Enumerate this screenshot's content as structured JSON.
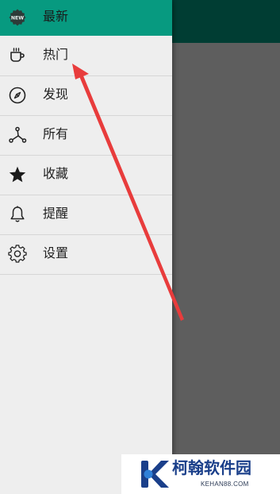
{
  "drawer": {
    "items": [
      {
        "label": "最新",
        "icon": "new-badge-icon",
        "selected": true
      },
      {
        "label": "热门",
        "icon": "coffee-cup-icon",
        "selected": false
      },
      {
        "label": "发现",
        "icon": "compass-icon",
        "selected": false
      },
      {
        "label": "所有",
        "icon": "share-nodes-icon",
        "selected": false
      },
      {
        "label": "收藏",
        "icon": "star-icon",
        "selected": false
      },
      {
        "label": "提醒",
        "icon": "bell-icon",
        "selected": false
      },
      {
        "label": "设置",
        "icon": "gear-icon",
        "selected": false
      }
    ]
  },
  "badge": {
    "text": "NEW"
  },
  "colors": {
    "selected_background": "#079a80",
    "drawer_background": "#eeeeee",
    "app_topbar": "#003d33",
    "scrim": "#5e5e5e",
    "annotation_arrow": "#e83c3c"
  },
  "watermark": {
    "title": "柯翰软件园",
    "subtitle": "KEHAN88.COM"
  }
}
